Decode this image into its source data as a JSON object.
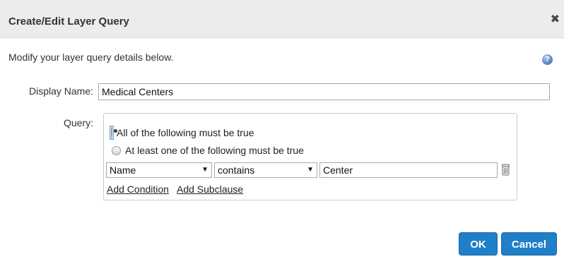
{
  "dialog": {
    "title": "Create/Edit Layer Query",
    "close_glyph": "✖",
    "intro": "Modify your layer query details below.",
    "help_glyph": "?"
  },
  "form": {
    "display_name_label": "Display Name:",
    "display_name_value": "Medical Centers",
    "query_label": "Query:"
  },
  "query": {
    "match_options": [
      {
        "label": "All of the following must be true",
        "selected": true
      },
      {
        "label": "At least one of the following must be true",
        "selected": false
      }
    ],
    "condition": {
      "field": "Name",
      "operator": "contains",
      "value": "Center"
    },
    "add_condition_label": "Add Condition",
    "add_subclause_label": "Add Subclause",
    "dropdown_arrow": "▼"
  },
  "buttons": {
    "ok": "OK",
    "cancel": "Cancel"
  },
  "icons": {
    "close": "close-icon",
    "help": "help-icon",
    "delete": "trash-icon"
  },
  "colors": {
    "primary_button": "#1f7fc9",
    "titlebar": "#ececec"
  }
}
